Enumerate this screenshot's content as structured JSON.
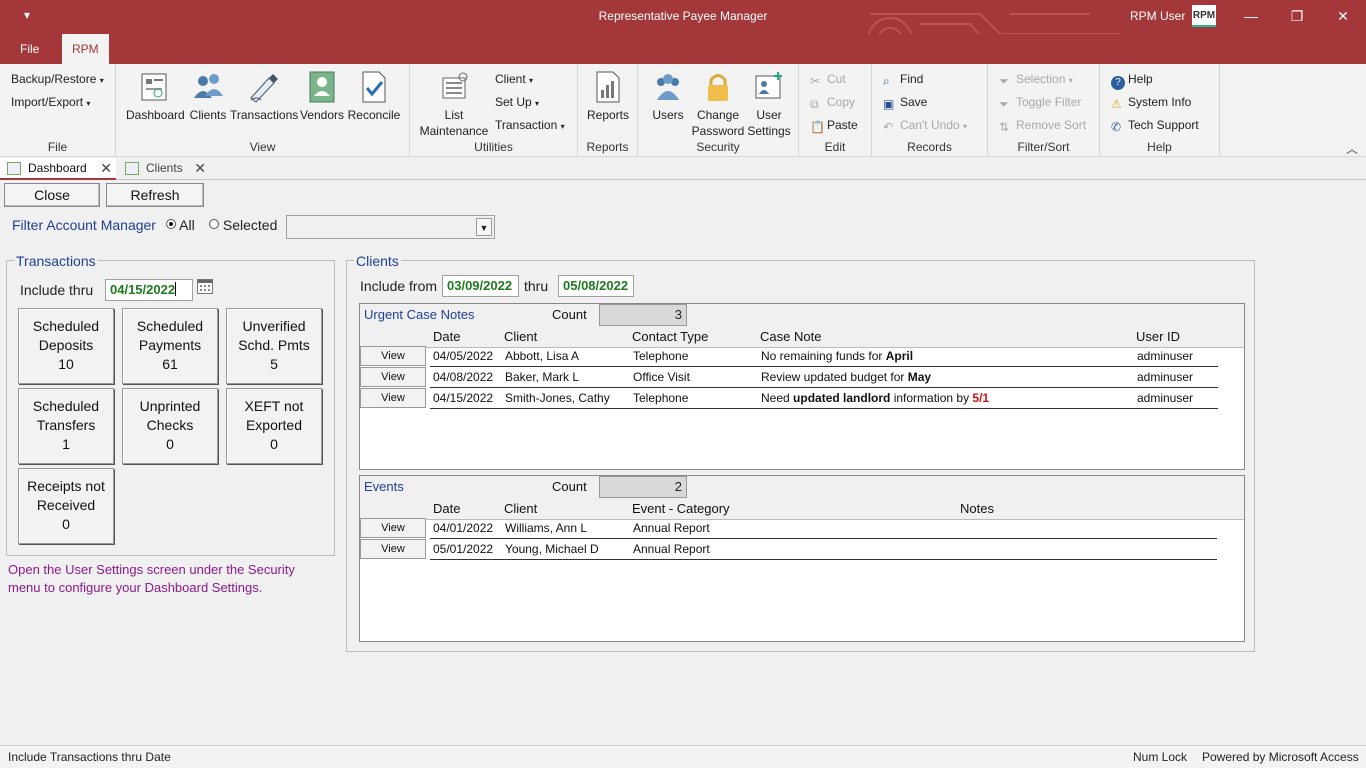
{
  "titlebar": {
    "qat": "▾",
    "title": "Representative Payee Manager",
    "user": "RPM User",
    "logo": "RPM",
    "min": "—",
    "restore": "❐",
    "close": "✕"
  },
  "tabs": {
    "file": "File",
    "rpm": "RPM"
  },
  "ribbon": {
    "file_group": {
      "backup": "Backup/Restore",
      "import": "Import/Export",
      "label": "File"
    },
    "view_group": {
      "dashboard": "Dashboard",
      "clients": "Clients",
      "transactions": "Transactions",
      "vendors": "Vendors",
      "reconcile": "Reconcile",
      "label": "View"
    },
    "utilities_group": {
      "list1": "List",
      "list2": "Maintenance",
      "client": "Client",
      "setup": "Set Up",
      "transaction": "Transaction",
      "label": "Utilities"
    },
    "reports_group": {
      "reports": "Reports",
      "label": "Reports"
    },
    "security_group": {
      "users": "Users",
      "change1": "Change",
      "change2": "Password",
      "user1": "User",
      "user2": "Settings",
      "label": "Security"
    },
    "edit_group": {
      "cut": "Cut",
      "copy": "Copy",
      "paste": "Paste",
      "label": "Edit"
    },
    "records_group": {
      "find": "Find",
      "save": "Save",
      "undo": "Can't Undo",
      "label": "Records"
    },
    "filter_group": {
      "selection": "Selection",
      "toggle": "Toggle Filter",
      "remove": "Remove Sort",
      "label": "Filter/Sort"
    },
    "help_group": {
      "help": "Help",
      "sysinfo": "System Info",
      "support": "Tech Support",
      "label": "Help"
    },
    "collapse": "︿"
  },
  "doctabs": [
    {
      "label": "Dashboard"
    },
    {
      "label": "Clients"
    }
  ],
  "form": {
    "close": "Close",
    "refresh": "Refresh",
    "filter_label": "Filter Account Manager",
    "radio_all": "All",
    "radio_selected": "Selected",
    "transactions": {
      "title": "Transactions",
      "include_thru": "Include thru",
      "date": "04/15/2022",
      "tiles": [
        {
          "l1": "Scheduled",
          "l2": "Deposits",
          "v": "10"
        },
        {
          "l1": "Scheduled",
          "l2": "Payments",
          "v": "61"
        },
        {
          "l1": "Unverified",
          "l2": "Schd. Pmts",
          "v": "5"
        },
        {
          "l1": "Scheduled",
          "l2": "Transfers",
          "v": "1"
        },
        {
          "l1": "Unprinted",
          "l2": "Checks",
          "v": "0"
        },
        {
          "l1": "XEFT not",
          "l2": "Exported",
          "v": "0"
        },
        {
          "l1": "Receipts not",
          "l2": "Received",
          "v": "0"
        }
      ],
      "hint1": "Open the User Settings screen under the Security",
      "hint2": "menu to configure your Dashboard Settings."
    },
    "clients": {
      "title": "Clients",
      "include_from": "Include from",
      "from": "03/09/2022",
      "thru": "thru",
      "to": "05/08/2022",
      "urgent": {
        "title": "Urgent Case Notes",
        "count_label": "Count",
        "count": "3",
        "cols": {
          "date": "Date",
          "client": "Client",
          "contact": "Contact Type",
          "note": "Case Note",
          "user": "User ID"
        },
        "view": "View",
        "rows": [
          {
            "date": "04/05/2022",
            "client": "Abbott, Lisa A",
            "contact": "Telephone",
            "n1": "No remaining funds for ",
            "n2": "April",
            "n3": "",
            "n4": "",
            "n5": "",
            "user": "adminuser"
          },
          {
            "date": "04/08/2022",
            "client": "Baker, Mark L",
            "contact": "Office Visit",
            "n1": "Review updated budget for ",
            "n2": "May",
            "n3": "",
            "n4": "",
            "n5": "",
            "user": "adminuser"
          },
          {
            "date": "04/15/2022",
            "client": "Smith-Jones, Cathy",
            "contact": "Telephone",
            "n1": "Need ",
            "n2": "updated landlord",
            "n3": " information by ",
            "n4": "5/1",
            "n5": "",
            "user": "adminuser"
          }
        ]
      },
      "events": {
        "title": "Events",
        "count_label": "Count",
        "count": "2",
        "cols": {
          "date": "Date",
          "client": "Client",
          "category": "Event - Category",
          "notes": "Notes"
        },
        "view": "View",
        "rows": [
          {
            "date": "04/01/2022",
            "client": "Williams, Ann L",
            "category": "Annual Report"
          },
          {
            "date": "05/01/2022",
            "client": "Young, Michael D",
            "category": "Annual Report"
          }
        ]
      }
    }
  },
  "status": {
    "left": "Include Transactions thru Date",
    "numlock": "Num Lock",
    "powered": "Powered by Microsoft Access"
  },
  "colors": {
    "accent": "#a4373a",
    "label_blue": "#1f3f95",
    "date_green": "#1e7a1e",
    "hint_purple": "#8b1a8b"
  }
}
